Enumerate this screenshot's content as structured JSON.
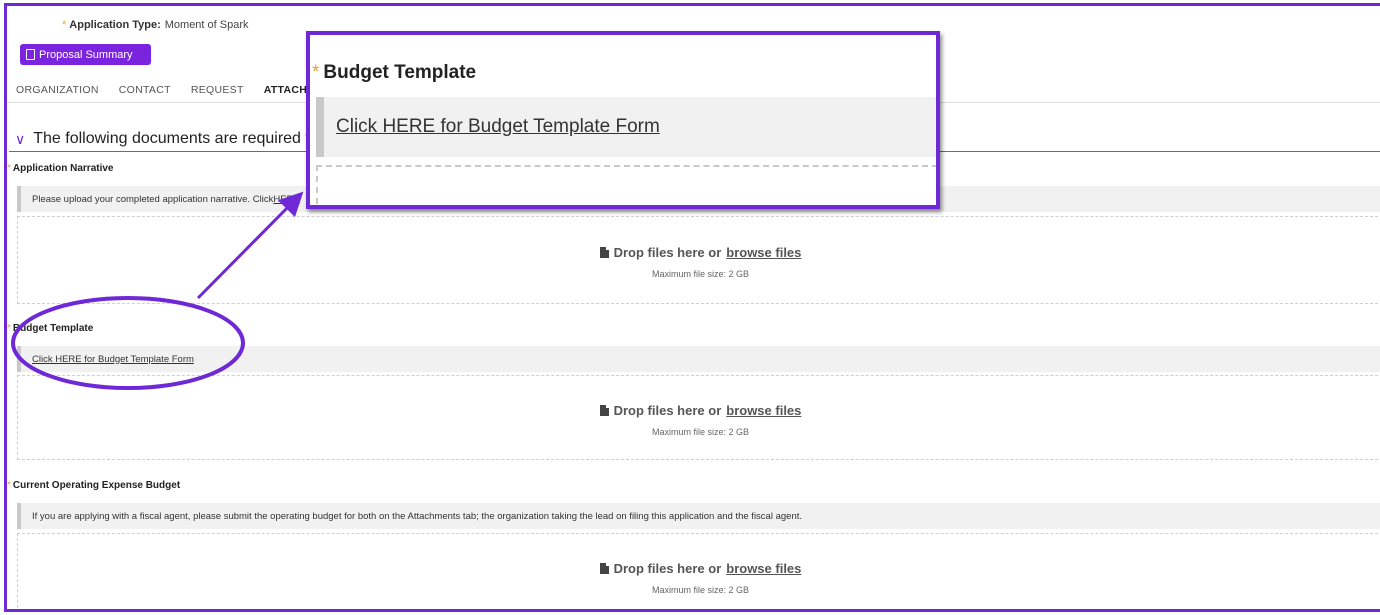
{
  "app_type": {
    "label": "Application Type:",
    "value": "Moment of Spark",
    "required_mark": "*"
  },
  "proposal_button": {
    "label": "Proposal Summary",
    "icon": "document-icon"
  },
  "tabs": [
    {
      "label": "ORGANIZATION",
      "active": false
    },
    {
      "label": "CONTACT",
      "active": false
    },
    {
      "label": "REQUEST",
      "active": false
    },
    {
      "label": "ATTACHMEN",
      "active": true
    }
  ],
  "section": {
    "title": "The following documents are required f",
    "icon": "chevron-down-icon"
  },
  "fields": [
    {
      "label": "Application Narrative",
      "info": "Please upload your completed application narrative. Click ",
      "info_link": "HERE",
      "drop_text": "Drop files here or ",
      "browse_text": "browse files",
      "max_size": "Maximum file size: 2 GB"
    },
    {
      "label": "Budget Template",
      "info_link": "Click HERE for Budget Template Form",
      "drop_text": "Drop files here or ",
      "browse_text": "browse files",
      "max_size": "Maximum file size: 2 GB"
    },
    {
      "label": "Current Operating Expense Budget",
      "info": "If you are applying with a fiscal agent, please submit the operating budget for both on the Attachments tab; the organization taking the lead on filing this application and the fiscal agent.",
      "drop_text": "Drop files here or ",
      "browse_text": "browse files",
      "max_size": "Maximum file size: 2 GB"
    }
  ],
  "zoom_popup": {
    "title": "Budget Template",
    "link": "Click HERE for Budget Template Form"
  },
  "colors": {
    "accent": "#6e28d6",
    "button": "#7a24e0",
    "required": "#f0a030"
  }
}
